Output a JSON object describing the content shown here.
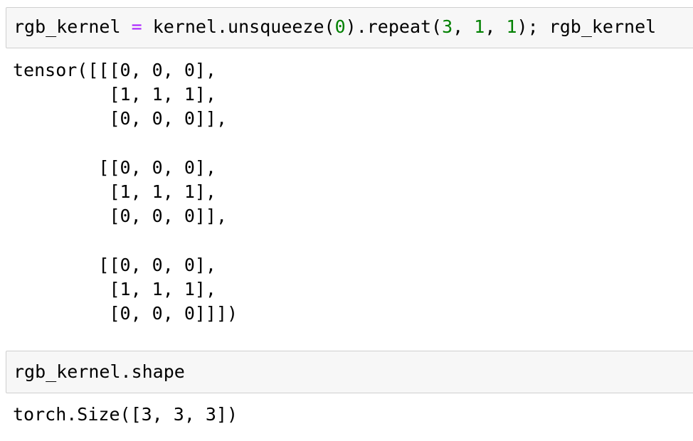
{
  "cells": [
    {
      "input": {
        "var": "rgb_kernel",
        "op": "=",
        "call_a": "kernel.unsqueeze(",
        "arg0": "0",
        "call_b": ").repeat(",
        "num_a": "3",
        "sep_a": ", ",
        "num_b": "1",
        "sep_b": ", ",
        "num_c": "1",
        "tail": "); rgb_kernel"
      },
      "output": "tensor([[[0, 0, 0],\n         [1, 1, 1],\n         [0, 0, 0]],\n\n        [[0, 0, 0],\n         [1, 1, 1],\n         [0, 0, 0]],\n\n        [[0, 0, 0],\n         [1, 1, 1],\n         [0, 0, 0]]])"
    },
    {
      "input": {
        "code": "rgb_kernel.shape"
      },
      "output": "torch.Size([3, 3, 3])"
    }
  ],
  "colors": {
    "input_background": "#f7f7f7",
    "input_border": "#cfcfcf",
    "operator": "#aa22ff",
    "number": "#008000"
  }
}
